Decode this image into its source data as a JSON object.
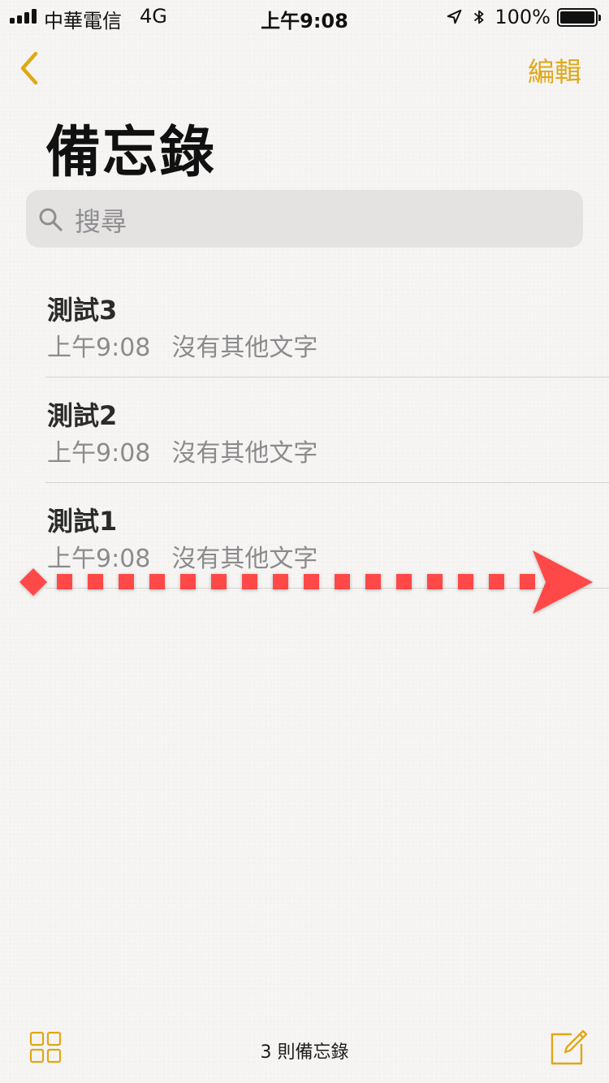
{
  "status_bar": {
    "carrier": "中華電信",
    "network": "4G",
    "time": "上午9:08",
    "battery_percent": "100%",
    "icons": [
      "signal-icon",
      "location-arrow-icon",
      "bluetooth-icon",
      "battery-icon"
    ]
  },
  "nav": {
    "back_icon": "chevron-left-icon",
    "edit_label": "編輯"
  },
  "page": {
    "title": "備忘錄"
  },
  "search": {
    "placeholder": "搜尋"
  },
  "notes": [
    {
      "title": "測試3",
      "time": "上午9:08",
      "preview": "沒有其他文字"
    },
    {
      "title": "測試2",
      "time": "上午9:08",
      "preview": "沒有其他文字"
    },
    {
      "title": "測試1",
      "time": "上午9:08",
      "preview": "沒有其他文字"
    }
  ],
  "toolbar": {
    "gallery_icon": "grid-view-icon",
    "note_count": "3 則備忘錄",
    "compose_icon": "compose-note-icon"
  },
  "colors": {
    "accent": "#e0a717",
    "swipe_arrow": "#ff4a4a",
    "background": "#f6f5f3"
  }
}
